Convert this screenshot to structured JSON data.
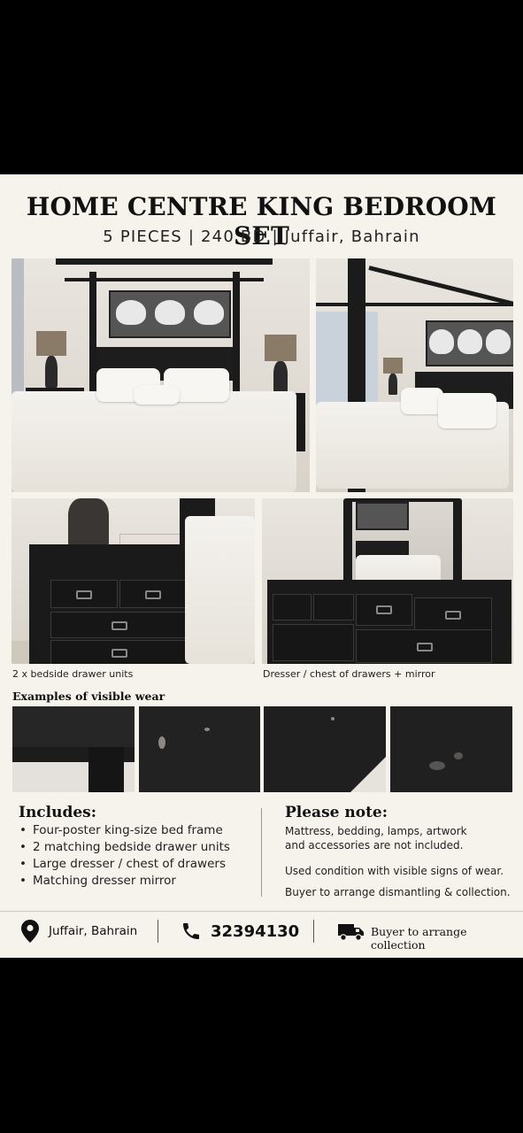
{
  "header": {
    "title": "HOME CENTRE KING BEDROOM SET",
    "subtitle": "5 PIECES  |  240 BD  |  Juffair, Bahrain"
  },
  "photos": {
    "caption_bedside": "2 x bedside drawer units",
    "caption_dresser": "Dresser / chest of drawers + mirror"
  },
  "wear": {
    "title": "Examples of visible wear"
  },
  "includes": {
    "title": "Includes:",
    "items": [
      "Four-poster king-size bed frame",
      "2 matching bedside drawer units",
      "Large dresser / chest of drawers",
      "Matching dresser mirror"
    ]
  },
  "note": {
    "title": "Please note:",
    "line1": "Mattress, bedding, lamps, artwork",
    "line2": "and accessories are not included.",
    "line3": "Used condition with visible signs of wear.",
    "line4": "Buyer to arrange dismantling & collection."
  },
  "footer": {
    "location": "Juffair, Bahrain",
    "phone": "32394130",
    "collection": "Buyer to arrange collection"
  },
  "icons": {
    "location": "location-pin-icon",
    "phone": "phone-icon",
    "truck": "delivery-truck-icon"
  },
  "colors": {
    "card_bg": "#f6f2ec",
    "furniture": "#1b1b1b",
    "text": "#111111"
  }
}
